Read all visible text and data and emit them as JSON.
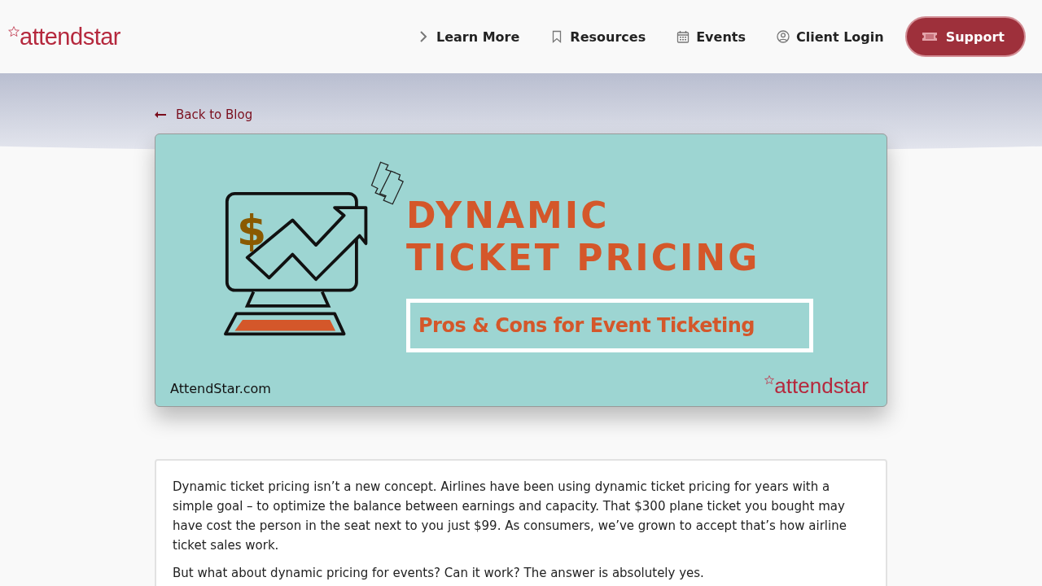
{
  "header": {
    "logo": "attendstar",
    "nav": [
      {
        "label": "Learn More"
      },
      {
        "label": "Resources"
      },
      {
        "label": "Events"
      },
      {
        "label": "Client Login"
      }
    ],
    "cta": {
      "label": "Support"
    }
  },
  "back_link": "Back to Blog",
  "hero": {
    "title_lines": [
      "DYNAMIC",
      "TICKET PRICING"
    ],
    "subtitle": "Pros & Cons for Event Ticketing",
    "site": "AttendStar.com",
    "logo": "attendstar",
    "dollar": "$"
  },
  "article": {
    "paragraphs": [
      "Dynamic ticket pricing isn’t a new concept. Airlines have been using dynamic ticket pricing for years with a simple goal – to optimize the balance between earnings and capacity. That $300 plane ticket you bought may have cost the person in the seat next to you just $99. As consumers, we’ve grown to accept that’s how airline ticket sales work.",
      "But what about dynamic pricing for events? Can it work? The answer is absolutely yes."
    ]
  }
}
